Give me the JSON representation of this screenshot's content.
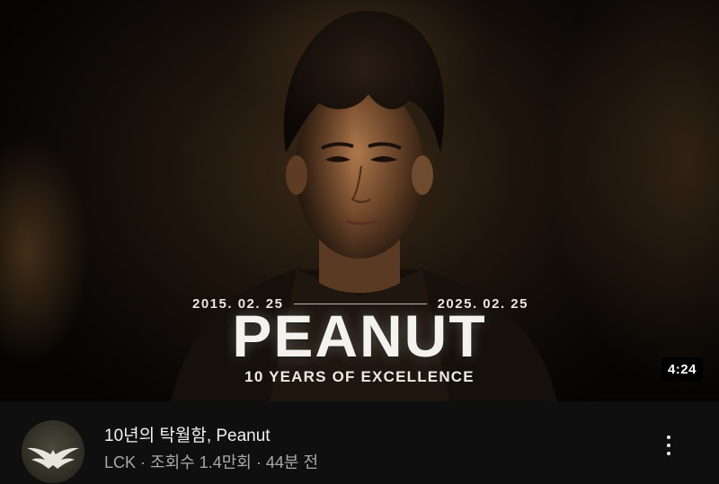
{
  "thumbnail": {
    "date_start": "2015. 02. 25",
    "date_end": "2025. 02. 25",
    "title": "PEANUT",
    "subtitle": "10 YEARS OF EXCELLENCE",
    "duration": "4:24"
  },
  "video": {
    "title": "10년의 탁월함, Peanut",
    "channel": "LCK",
    "separator": "·",
    "views": "조회수 1.4만회",
    "age": "44분 전"
  },
  "channel_avatar": {
    "icon": "eagle-wings-logo-icon"
  },
  "menu": {
    "icon": "more-vertical-icon"
  },
  "colors": {
    "background": "#0f0f0f",
    "title_text": "#f1f1f1",
    "secondary_text": "#a9a9a9",
    "duration_badge": "#000000"
  }
}
